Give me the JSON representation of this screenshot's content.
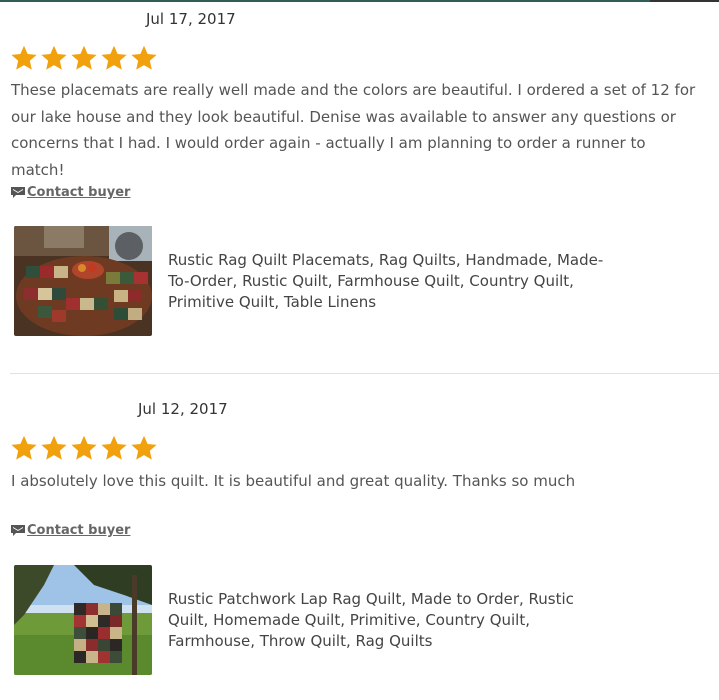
{
  "reviews": [
    {
      "date": "Jul 17, 2017",
      "rating": 5,
      "text": "These placemats are really well made and the colors are beautiful. I ordered a set of 12 for our lake house and they look beautiful. Denise was available to answer any questions or concerns that I had. I would order again - actually I am planning to order a runner to match!",
      "contact_label": "Contact buyer",
      "contact_icon": "flag-message-icon",
      "listing_title": "Rustic Rag Quilt Placemats, Rag Quilts, Handmade, Made-To-Order, Rustic Quilt, Farmhouse Quilt, Country Quilt, Primitive Quilt, Table Linens"
    },
    {
      "date": "Jul 12, 2017",
      "rating": 5,
      "text": "I absolutely love this quilt. It is beautiful and great quality. Thanks so much",
      "contact_label": "Contact buyer",
      "contact_icon": "flag-message-icon",
      "listing_title": "Rustic Patchwork Lap Rag Quilt, Made to Order, Rustic Quilt, Homemade Quilt, Primitive, Country Quilt, Farmhouse, Throw Quilt, Rag Quilts"
    }
  ],
  "colors": {
    "star": "#f1a10d",
    "text": "#555555",
    "divider": "#e1e1e1"
  }
}
